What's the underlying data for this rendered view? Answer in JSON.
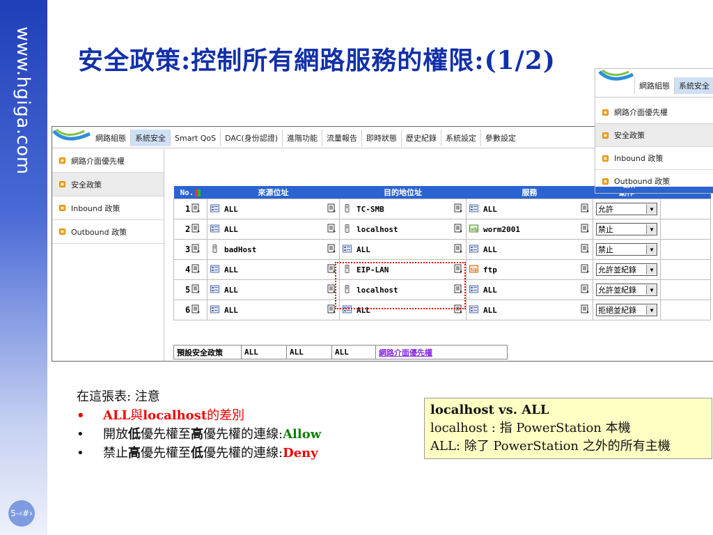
{
  "side": {
    "url": "www.hgiga.com",
    "slide_number": "5-‹#›"
  },
  "title": "安全政策:控制所有網路服務的權限:(1/2)",
  "nav": {
    "tabs": [
      "網路組態",
      "系統安全",
      "Smart QoS",
      "DAC(身份認證)",
      "進階功能",
      "流量報告",
      "即時狀態",
      "歷史紀錄",
      "系統設定",
      "參數設定"
    ],
    "active_tab": "系統安全"
  },
  "menu": {
    "items": [
      "網路介面優先權",
      "安全政策",
      "Inbound 政策",
      "Outbound 政策"
    ],
    "active_item": "安全政策"
  },
  "table": {
    "headers": {
      "no": "No.",
      "source": "來源位址",
      "dest": "目的地位址",
      "service": "服務",
      "action": "動作"
    },
    "rows": [
      {
        "no": "1",
        "src": "ALL",
        "src_icon": "network-icon",
        "dst": "TC-SMB",
        "dst_icon": "host-icon",
        "svc": "ALL",
        "svc_icon": "network-icon",
        "action": "允許"
      },
      {
        "no": "2",
        "src": "ALL",
        "src_icon": "network-icon",
        "dst": "localhost",
        "dst_icon": "host-icon",
        "svc": "worm2001",
        "svc_icon": "udp-icon",
        "action": "禁止"
      },
      {
        "no": "3",
        "src": "badHost",
        "src_icon": "host-icon",
        "dst": "ALL",
        "dst_icon": "network-icon",
        "svc": "ALL",
        "svc_icon": "network-icon",
        "action": "禁止"
      },
      {
        "no": "4",
        "src": "ALL",
        "src_icon": "network-icon",
        "dst": "EIP-LAN",
        "dst_icon": "host-icon",
        "svc": "ftp",
        "svc_icon": "tcp-icon",
        "action": "允許並紀錄"
      },
      {
        "no": "5",
        "src": "ALL",
        "src_icon": "network-icon",
        "dst": "localhost",
        "dst_icon": "host-icon",
        "svc": "ALL",
        "svc_icon": "network-icon",
        "action": "允許並紀錄"
      },
      {
        "no": "6",
        "src": "ALL",
        "src_icon": "network-icon",
        "dst": "ALL",
        "dst_icon": "network-icon",
        "svc": "ALL",
        "svc_icon": "network-icon",
        "action": "拒絕並紀錄"
      }
    ],
    "default_row": {
      "label": "預設安全政策",
      "c1": "ALL",
      "c2": "ALL",
      "c3": "ALL",
      "link": "網路介面優先權"
    }
  },
  "inset": {
    "tabs": [
      "網路組態",
      "系統安全"
    ],
    "items": [
      "網路介面優先權",
      "安全政策",
      "Inbound 政策",
      "Outbound 政策"
    ],
    "partial_header": "動作"
  },
  "notes": {
    "intro": "在這張表: 注意",
    "b1": {
      "bullet": "•",
      "a": "ALL",
      "b": " 與 ",
      "c": "localhost",
      "d": " 的差別"
    },
    "b2": {
      "bullet": "•",
      "a": "開放 ",
      "b": "低",
      "c": " 優先權至 ",
      "d": "高",
      "e": " 優先權的連線: ",
      "f": "Allow"
    },
    "b3": {
      "bullet": "•",
      "a": "禁止 ",
      "b": "高",
      "c": " 優先權至 ",
      "d": "低",
      "e": " 優先權的連線: ",
      "f": "Deny"
    }
  },
  "yellow_box": {
    "line1": "localhost vs. ALL",
    "line2": "localhost : 指 PowerStation 本機",
    "line3": "ALL: 除了 PowerStation 之外的所有主機"
  },
  "colors": {
    "title": "#1230a8",
    "header": "#2b63d0",
    "red": "#e00000",
    "green": "#0a7f0a",
    "note_bg": "#ffffc4"
  }
}
